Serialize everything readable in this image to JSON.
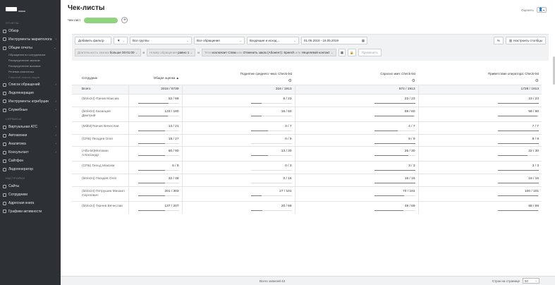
{
  "sidebar": {
    "sections": [
      {
        "head": "ОТЧЕТЫ",
        "items": [
          {
            "label": "Обзор",
            "icon": "dashboard-icon"
          },
          {
            "label": "Инструменты маркетолога",
            "icon": "marketing-icon",
            "chev": "›"
          },
          {
            "label": "Общие отчеты",
            "icon": "reports-icon",
            "chev": "⌄",
            "subs": [
              "Обращения по сотрудникам",
              "Распределение звонков",
              "Распределение вызовов",
              "Речевая аналитика",
              "Сквозной анализ лидов"
            ]
          },
          {
            "label": "Список обращений",
            "icon": "list-icon",
            "chev": "›"
          },
          {
            "label": "Лидогенерация",
            "icon": "leadgen-icon"
          },
          {
            "label": "Инструменты атрибуции",
            "icon": "attribution-icon",
            "chev": "›"
          },
          {
            "label": "Служебные",
            "icon": "service-icon",
            "chev": "›"
          }
        ]
      },
      {
        "head": "СЕРВИСЫ",
        "items": [
          {
            "label": "Виртуальная АТС",
            "icon": "pbx-icon",
            "chev": "›"
          },
          {
            "label": "Автозвонки",
            "icon": "autocall-icon",
            "chev": "›"
          },
          {
            "label": "Аналитика",
            "icon": "analytics-icon",
            "chev": "›"
          },
          {
            "label": "Консультант",
            "icon": "consultant-icon",
            "chev": "›"
          },
          {
            "label": "Сайтфон",
            "icon": "sitephone-icon"
          },
          {
            "label": "Лидогенератор",
            "icon": "leadgenerator-icon"
          }
        ]
      },
      {
        "head": "НАСТРОЙКИ",
        "items": [
          {
            "label": "Сайты",
            "icon": "sites-icon"
          },
          {
            "label": "Сотрудники",
            "icon": "employees-icon"
          },
          {
            "label": "Адресная книга",
            "icon": "addressbook-icon"
          },
          {
            "label": "Графики активности",
            "icon": "schedule-icon"
          }
        ]
      }
    ]
  },
  "header": {
    "title": "Чек-листы",
    "rate_label": "Оценить",
    "tab_label": "Чек-лист",
    "add_label": "+"
  },
  "filters": {
    "add_filter": "Добавить фильтр",
    "groups": "Все группы",
    "calls": "Все обращения",
    "direction": "Входящие и исход...",
    "date_range": "01.05.2019 - 16.05.2019",
    "columns_btn": "Настроить столбцы",
    "chips": [
      {
        "a": "Длительность звонка",
        "b": "больше 00:01:00"
      },
      {
        "a": "Номер обращения",
        "b": "равно 1"
      },
      {
        "a": "Теги",
        "b": "исключает Спам",
        "c": "или",
        "d": "Отменить заказ (Абонент): Speech",
        "e": "или",
        "f": "Нецелевой контакт"
      }
    ],
    "and": "и",
    "apply": "Применить"
  },
  "table": {
    "headers": [
      "Сотрудник",
      "Общая оценка",
      "Поднятие среднего чека: Check-list",
      "Спросил имя: Check-list",
      "Приветствие оператора: Check-list"
    ],
    "sort_mark": "▲",
    "settings_glyph": "⚙",
    "total": {
      "name": "Всего",
      "values": [
        "3018 / 5739",
        "316 / 1913",
        "974 / 1913",
        "1728 / 1913"
      ]
    },
    "rows": [
      {
        "name": "(bitrix24) Панов Максим",
        "values": [
          "52 / 69",
          "6 / 23",
          "23 / 23",
          "23 / 23"
        ],
        "fills": [
          0.75,
          0.26,
          1,
          1
        ]
      },
      {
        "name": "(bitrix24) Казанцев Дмитрий",
        "values": [
          "133 / 180",
          "16 / 60",
          "59 / 60",
          "58 / 60"
        ],
        "fills": [
          0.74,
          0.27,
          0.98,
          0.97
        ]
      },
      {
        "name": "(Mitbit)Ткачев Вячеслав",
        "values": [
          "14 / 21",
          "3 / 7",
          "4 / 7",
          "7 / 7"
        ],
        "fills": [
          0.67,
          0.43,
          0.57,
          1
        ]
      },
      {
        "name": "(СПБ) Гвоздев Олег",
        "values": [
          "18 / 27",
          "0 / 9",
          "9 / 9",
          "9 / 9"
        ],
        "fills": [
          0.67,
          0,
          1,
          1
        ]
      },
      {
        "name": "(Alfa-bit)Молокин Александр",
        "values": [
          "60 / 90",
          "13 / 30",
          "25 / 30",
          "22 / 30"
        ],
        "fills": [
          0.67,
          0.43,
          0.83,
          0.73
        ]
      },
      {
        "name": "(СПБ) Гильд Максим",
        "values": [
          "6 / 9",
          "0 / 3",
          "3 / 3",
          "3 / 3"
        ],
        "fills": [
          0.67,
          0,
          1,
          1
        ]
      },
      {
        "name": "(bitrix24) Гвоздев Олег",
        "values": [
          "32 / 48",
          "0 / 16",
          "16 / 16",
          "16 / 16"
        ],
        "fills": [
          0.67,
          0,
          1,
          1
        ]
      },
      {
        "name": "(bitrix24) Петрушин Михаил Сергеевич",
        "values": [
          "201 / 303",
          "27 / 101",
          "74 / 101",
          "100 / 101"
        ],
        "fills": [
          0.66,
          0.27,
          0.73,
          0.99
        ]
      },
      {
        "name": "(bitrix24) Ткачев Вячеслав",
        "values": [
          "137 / 207",
          "20 / 69",
          "49 / 69",
          "68 / 69"
        ],
        "fills": [
          0.66,
          0.29,
          0.71,
          0.99
        ]
      }
    ]
  },
  "footer": {
    "total_records": "Всего записей 43",
    "per_page_label": "Строк на странице",
    "per_page_value": "50"
  }
}
